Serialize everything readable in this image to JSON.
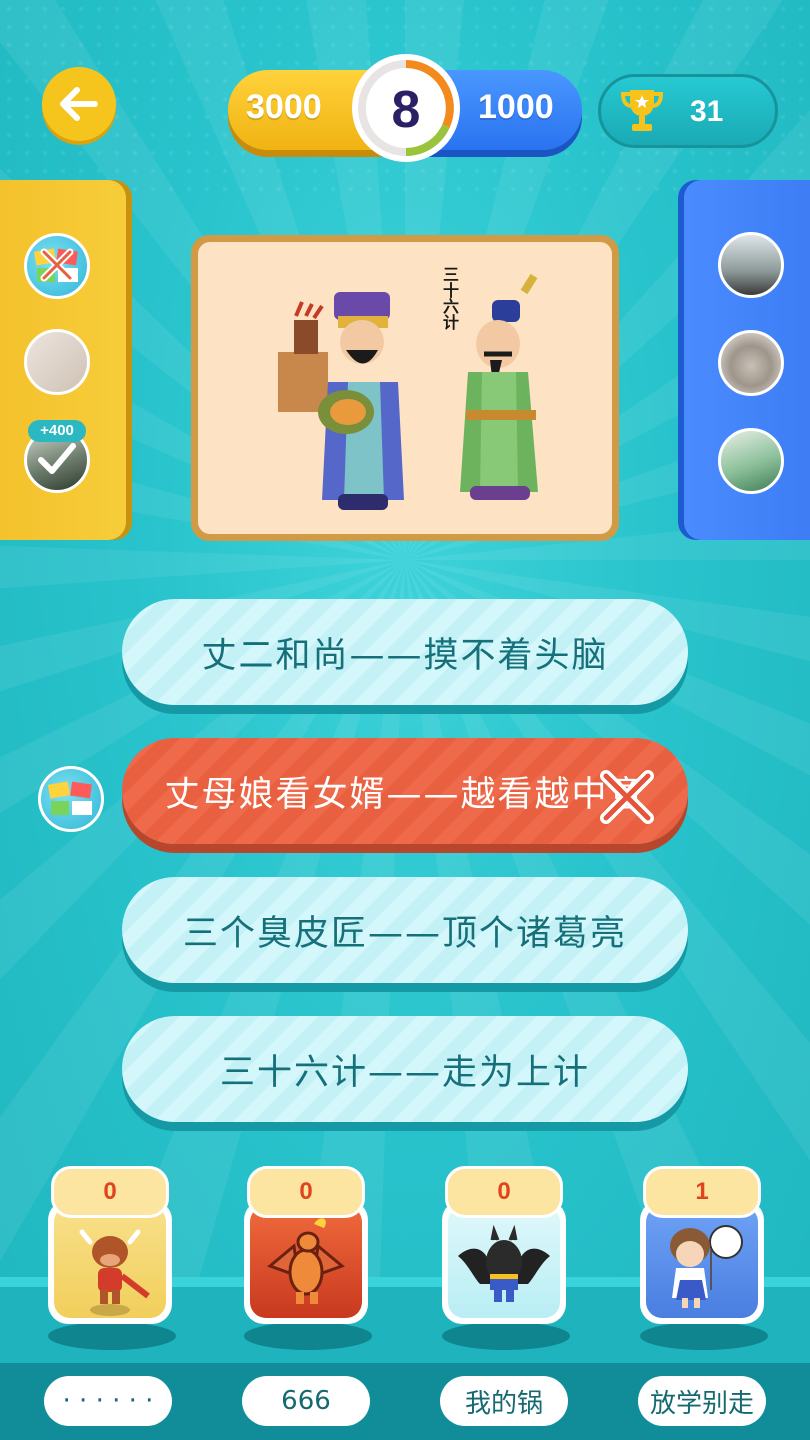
{
  "header": {
    "back_icon": "arrow-left-icon",
    "score_left": "3000",
    "score_right": "1000",
    "timer": "8",
    "trophy_icon": "trophy-icon",
    "trophy_count": "31"
  },
  "left_panel": {
    "bonus_badge": "+400",
    "players": [
      {
        "status": "wrong"
      },
      {
        "status": "none"
      },
      {
        "status": "correct"
      }
    ]
  },
  "question": {
    "image_caption": "三十六计"
  },
  "answers": [
    {
      "label": "丈二和尚——摸不着头脑",
      "state": "normal"
    },
    {
      "label": "丈母娘看女婿——越看越中意",
      "state": "wrong"
    },
    {
      "label": "三个臭皮匠——顶个诸葛亮",
      "state": "normal"
    },
    {
      "label": "三十六计——走为上计",
      "state": "normal"
    }
  ],
  "bottom_players": [
    {
      "count": "0",
      "nickname": "· · · · · ·"
    },
    {
      "count": "0",
      "nickname": "666"
    },
    {
      "count": "0",
      "nickname": "我的锅"
    },
    {
      "count": "1",
      "nickname": "放学别走"
    }
  ],
  "colors": {
    "bg": "#22bfc8",
    "gold": "#f5c51d",
    "blue": "#2a73f0",
    "wrong": "#e8603f",
    "answer_text": "#16707a"
  }
}
